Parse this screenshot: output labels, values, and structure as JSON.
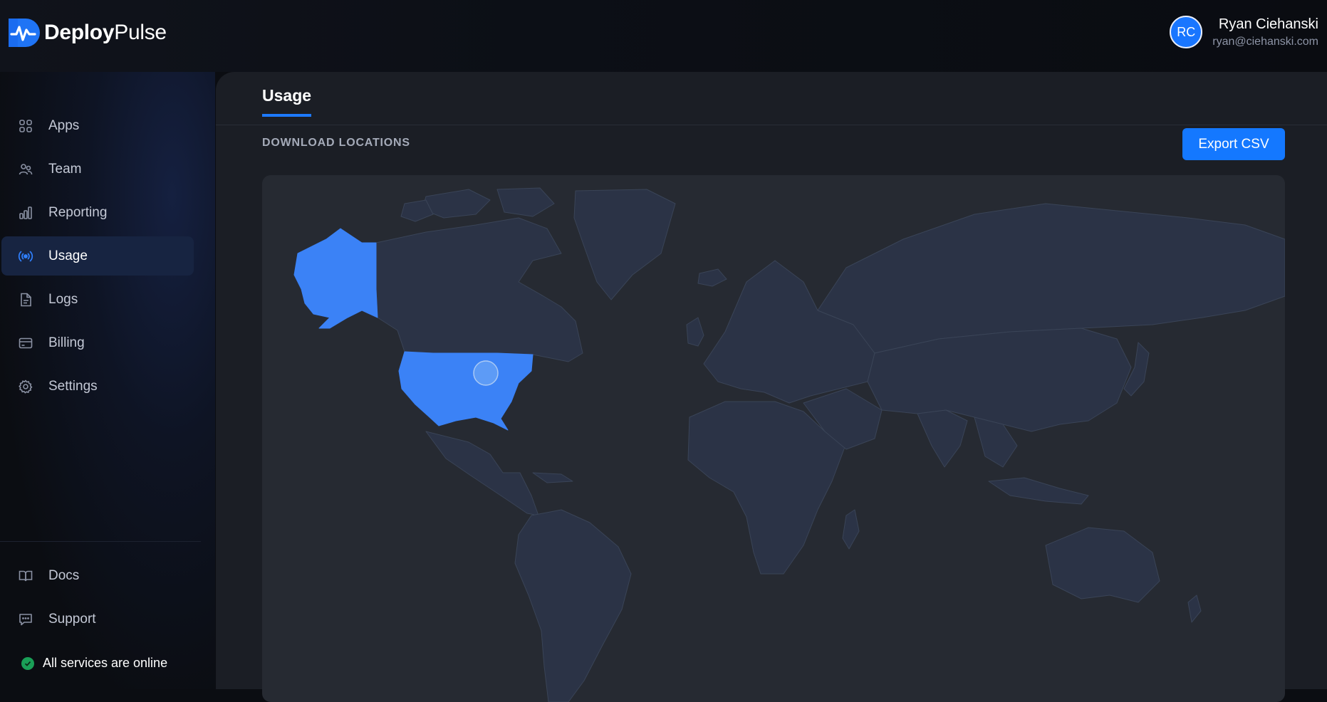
{
  "app": {
    "brand_bold": "Deploy",
    "brand_light": "Pulse"
  },
  "user": {
    "initials": "RC",
    "name": "Ryan Ciehanski",
    "email": "ryan@ciehanski.com"
  },
  "sidebar": {
    "items": [
      {
        "label": "Apps",
        "icon": "apps-grid-icon"
      },
      {
        "label": "Team",
        "icon": "team-icon"
      },
      {
        "label": "Reporting",
        "icon": "bar-chart-icon"
      },
      {
        "label": "Usage",
        "icon": "broadcast-icon",
        "active": true
      },
      {
        "label": "Logs",
        "icon": "document-icon"
      },
      {
        "label": "Billing",
        "icon": "credit-card-icon"
      },
      {
        "label": "Settings",
        "icon": "gear-icon"
      }
    ],
    "bottom_items": [
      {
        "label": "Docs",
        "icon": "book-icon"
      },
      {
        "label": "Support",
        "icon": "chat-icon"
      }
    ],
    "status_text": "All services are online"
  },
  "main": {
    "tab_label": "Usage",
    "section_title": "DOWNLOAD LOCATIONS",
    "export_label": "Export CSV"
  },
  "map": {
    "highlighted_regions": [
      "United States",
      "Alaska"
    ],
    "highlight_color": "#3b82f6",
    "land_color": "#2b3346",
    "marker_region": "United States"
  },
  "colors": {
    "accent": "#1478ff",
    "status_online": "#1a9f57"
  }
}
